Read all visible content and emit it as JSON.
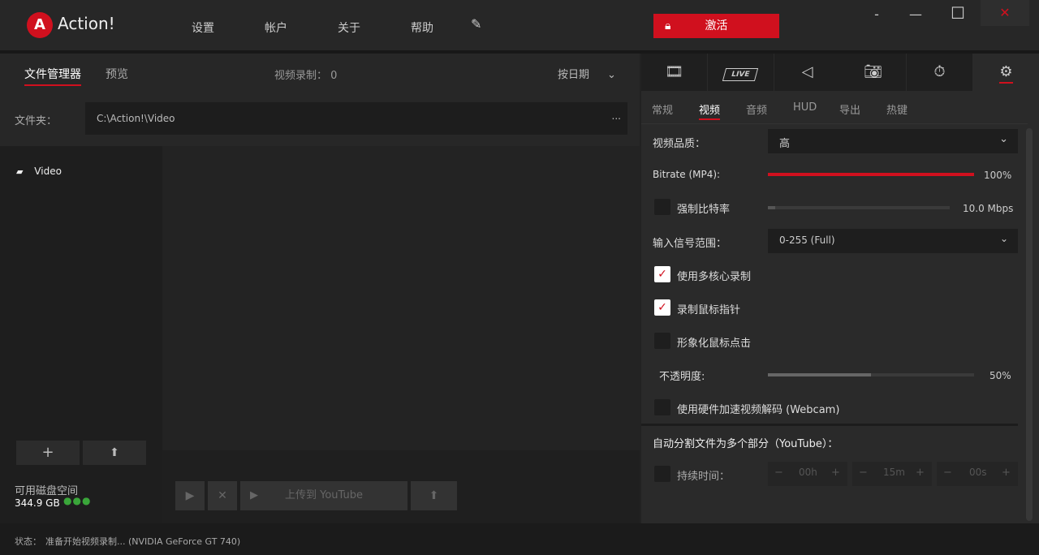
{
  "app": {
    "name": "Action!",
    "logo_letter": "A",
    "colors": {
      "accent": "#d0101e",
      "green": "#3aa63a"
    }
  },
  "menu": [
    "设置",
    "帐户",
    "关于",
    "帮助"
  ],
  "activate_label": "激活",
  "window": {
    "minimize": "-",
    "maximize": "—",
    "restore": "☐",
    "close": "✕"
  },
  "left": {
    "tabs": [
      "文件管理器",
      "预览"
    ],
    "recording_count_label": "视频录制：",
    "recording_count": "0",
    "sort_label": "按日期",
    "folder_label": "文件夹：",
    "folder_path": "C:\\Action!\\Video",
    "more": "...",
    "tree": [
      {
        "name": "Video"
      }
    ],
    "add": "+",
    "disk_label": "可用磁盘空间",
    "disk_value": "344.9 GB",
    "upload_youtube": "上传到 YouTube"
  },
  "status": {
    "label": "状态：",
    "text": "准备开始视频录制... (NVIDIA GeForce GT 740)"
  },
  "right": {
    "icon_tabs": [
      "film-icon",
      "live-icon",
      "audio-icon",
      "camera-icon",
      "timer-icon",
      "gear-icon"
    ],
    "live_text": "LIVE",
    "sub_tabs": [
      "常规",
      "视频",
      "音频",
      "HUD",
      "导出",
      "热键"
    ],
    "quality_label": "视频品质：",
    "quality_value": "高",
    "bitrate_label": "Bitrate (MP4):",
    "bitrate_value": "100%",
    "bitrate_fraction": 1.0,
    "force_bitrate_label": "强制比特率",
    "force_bitrate_value": "10.0 Mbps",
    "force_bitrate_fraction": 0.04,
    "input_range_label": "输入信号范围：",
    "input_range_value": "0-255 (Full)",
    "multicore_label": "使用多核心录制",
    "multicore_checked": true,
    "cursor_label": "录制鼠标指针",
    "cursor_checked": true,
    "click_label": "形象化鼠标点击",
    "click_checked": false,
    "opacity_label": "不透明度:",
    "opacity_value": "50%",
    "opacity_fraction": 0.5,
    "hw_label": "使用硬件加速视频解码 (Webcam)",
    "hw_checked": false,
    "split_header": "自动分割文件为多个部分（YouTube）：",
    "duration_label": "持续时间：",
    "duration": [
      "00h",
      "15m",
      "00s"
    ],
    "minus": "−",
    "plus": "+"
  }
}
